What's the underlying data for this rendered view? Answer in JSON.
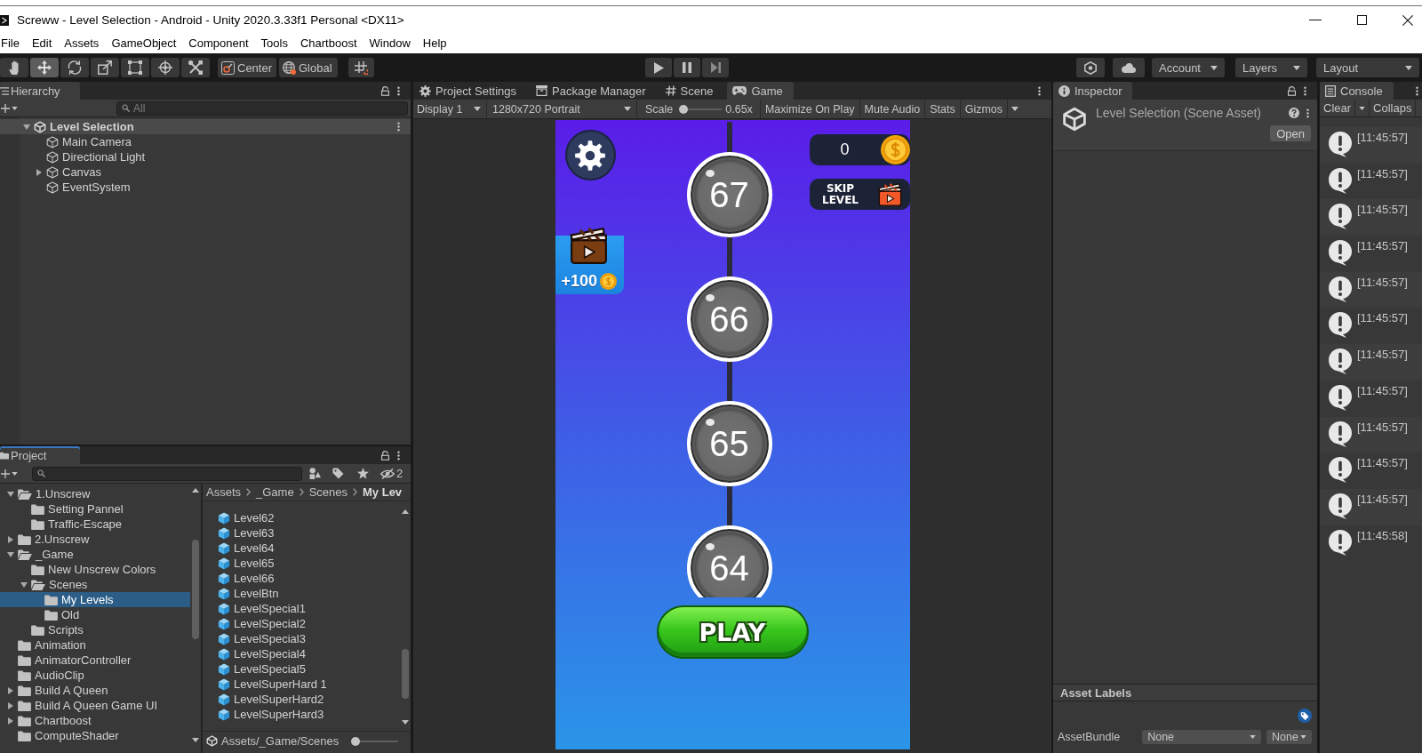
{
  "window": {
    "title": "Screww - Level Selection - Android - Unity 2020.3.33f1 Personal <DX11>"
  },
  "menu": [
    "File",
    "Edit",
    "Assets",
    "GameObject",
    "Component",
    "Tools",
    "Chartboost",
    "Window",
    "Help"
  ],
  "toolbar": {
    "tools": [
      {
        "kind": "hand",
        "selected": false
      },
      {
        "kind": "move",
        "selected": true
      },
      {
        "kind": "rotate",
        "selected": false
      },
      {
        "kind": "scale",
        "selected": false
      },
      {
        "kind": "rect",
        "selected": false
      },
      {
        "kind": "transform",
        "selected": false
      },
      {
        "kind": "custom",
        "selected": false
      }
    ],
    "pivot": "Center",
    "space": "Global",
    "account": "Account",
    "layers": "Layers",
    "layout": "Layout"
  },
  "hierarchy": {
    "tabs": [
      {
        "label": "Hierarchy",
        "kind": "hierarchy",
        "selected": true,
        "focused": false
      }
    ],
    "search": {
      "placeholder": "All"
    },
    "scene": {
      "name": "Level Selection",
      "expanded": true,
      "children": [
        {
          "name": "Main Camera"
        },
        {
          "name": "Directional Light"
        },
        {
          "name": "Canvas",
          "expanded": false
        },
        {
          "name": "EventSystem"
        }
      ]
    }
  },
  "project": {
    "tabs": [
      {
        "label": "Project",
        "kind": "project",
        "selected": true,
        "focused": true
      }
    ],
    "hidden_count": "2",
    "folders": [
      {
        "name": "1.Unscrew",
        "expanded": true,
        "selected": false,
        "children": [
          {
            "name": "Setting Pannel",
            "selected": false
          },
          {
            "name": "Traffic-Escape",
            "selected": false
          }
        ]
      },
      {
        "name": "2.Unscrew",
        "expanded": false,
        "selected": false
      },
      {
        "name": "_Game",
        "expanded": true,
        "selected": false,
        "children": [
          {
            "name": "New Unscrew Colors",
            "selected": false
          },
          {
            "name": "Scenes",
            "expanded": true,
            "selected": false,
            "children": [
              {
                "name": "My Levels",
                "selected": true
              },
              {
                "name": "Old",
                "selected": false
              }
            ]
          },
          {
            "name": "Scripts",
            "selected": false
          }
        ]
      },
      {
        "name": "Animation",
        "selected": false
      },
      {
        "name": "AnimatorController",
        "selected": false
      },
      {
        "name": "AudioClip",
        "selected": false
      },
      {
        "name": "Build A Queen",
        "expanded": false,
        "selected": false
      },
      {
        "name": "Build A Queen Game UI",
        "expanded": false,
        "selected": false
      },
      {
        "name": "Chartboost",
        "expanded": false,
        "selected": false
      },
      {
        "name": "ComputeShader",
        "selected": false
      }
    ],
    "breadcrumb": [
      "Assets",
      "_Game",
      "Scenes",
      "My Lev"
    ],
    "files": [
      "Level62",
      "Level63",
      "Level64",
      "Level65",
      "Level66",
      "LevelBtn",
      "LevelSpecial1",
      "LevelSpecial2",
      "LevelSpecial3",
      "LevelSpecial4",
      "LevelSpecial5",
      "LevelSuperHard 1",
      "LevelSuperHard2",
      "LevelSuperHard3"
    ],
    "path": "Assets/_Game/Scenes",
    "icon_size": {
      "level": 0
    }
  },
  "game": {
    "tabs": [
      {
        "label": "Project Settings",
        "kind": "settings",
        "selected": false
      },
      {
        "label": "Package Manager",
        "kind": "package",
        "selected": false
      },
      {
        "label": "Scene",
        "kind": "scene",
        "selected": false
      },
      {
        "label": "Game",
        "kind": "game",
        "selected": true
      }
    ],
    "display": "Display 1",
    "resolution": "1280x720 Portrait",
    "scale_label": "Scale",
    "scale": {
      "level": 0
    },
    "scale_reading": "0.65x",
    "toggles": [
      "Maximize On Play",
      "Mute Audio",
      "Stats"
    ],
    "gizmos": "Gizmos",
    "screen": {
      "coins": "0",
      "skip_level": "SKIP LEVEL",
      "reward": "+100",
      "levels": [
        "67",
        "66",
        "65",
        "64"
      ],
      "play": "PLAY"
    }
  },
  "inspector": {
    "tabs": [
      {
        "label": "Inspector",
        "kind": "inspector",
        "selected": true,
        "focused": false
      }
    ],
    "asset_title": "Level Selection (Scene Asset)",
    "open": "Open",
    "labels_header": "Asset Labels",
    "asset_bundle_label": "AssetBundle",
    "asset_bundle": "None",
    "variant": "None"
  },
  "console": {
    "tabs": [
      {
        "label": "Console",
        "kind": "console",
        "selected": true,
        "focused": false
      }
    ],
    "clear": "Clear",
    "collapse": "Collaps",
    "entries": [
      "[11:45:57]",
      "[11:45:57]",
      "[11:45:57]",
      "[11:45:57]",
      "[11:45:57]",
      "[11:45:57]",
      "[11:45:57]",
      "[11:45:57]",
      "[11:45:57]",
      "[11:45:57]",
      "[11:45:57]",
      "[11:45:58]"
    ]
  }
}
